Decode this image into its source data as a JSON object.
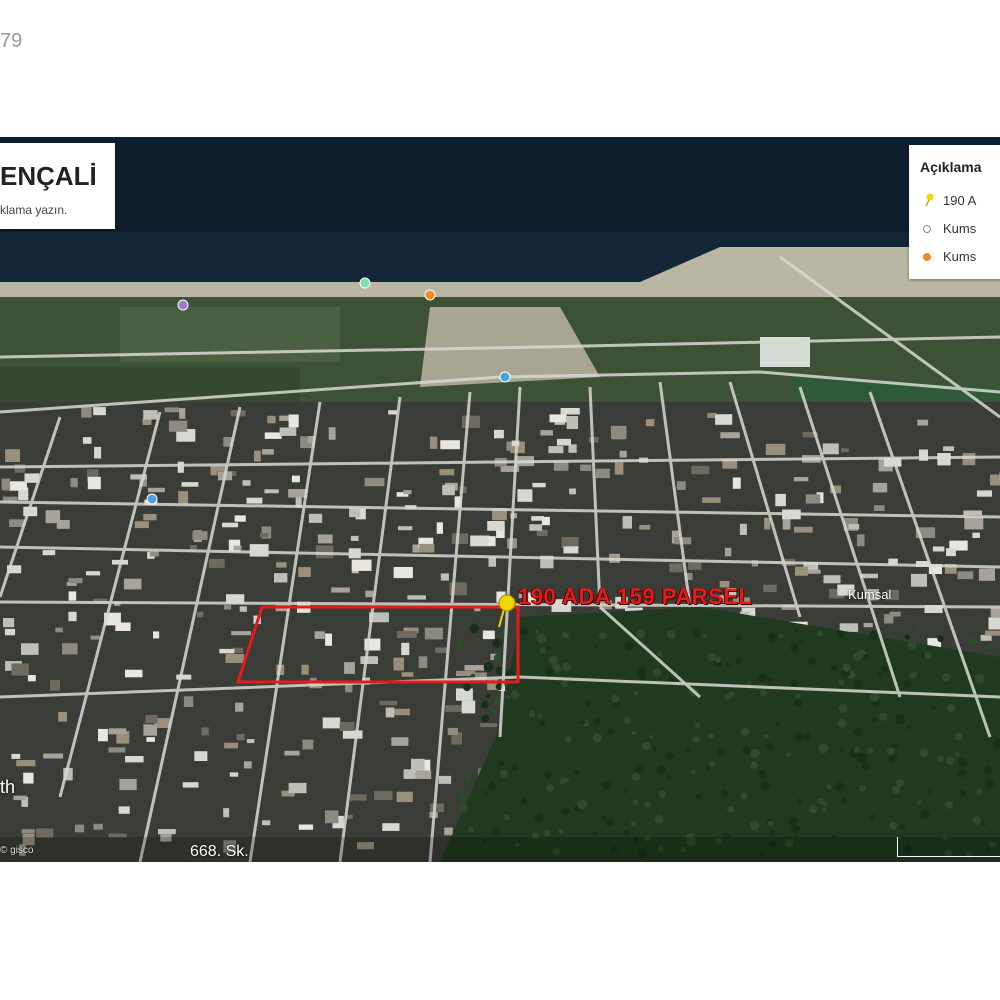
{
  "page": {
    "corner_text": "79"
  },
  "map": {
    "title": "ENÇALİ",
    "subtitle": "klama yazın.",
    "legend": {
      "title": "Açıklama",
      "items": [
        {
          "label": "190 A",
          "icon": "yellow-pushpin-icon",
          "color": "#f2d600"
        },
        {
          "label": "Kums",
          "icon": "grey-circle-pin-icon",
          "color": "#8a8a8a"
        },
        {
          "label": "Kums",
          "icon": "orange-circle-pin-icon",
          "color": "#f08a24"
        }
      ]
    },
    "parcel_label": "190 ADA 159 PARSEL",
    "parcel_color": "#e31b1b",
    "street_labels": [
      "Kumsal",
      "668. Sk."
    ],
    "watermark": "th",
    "copyright": "© gisco"
  }
}
